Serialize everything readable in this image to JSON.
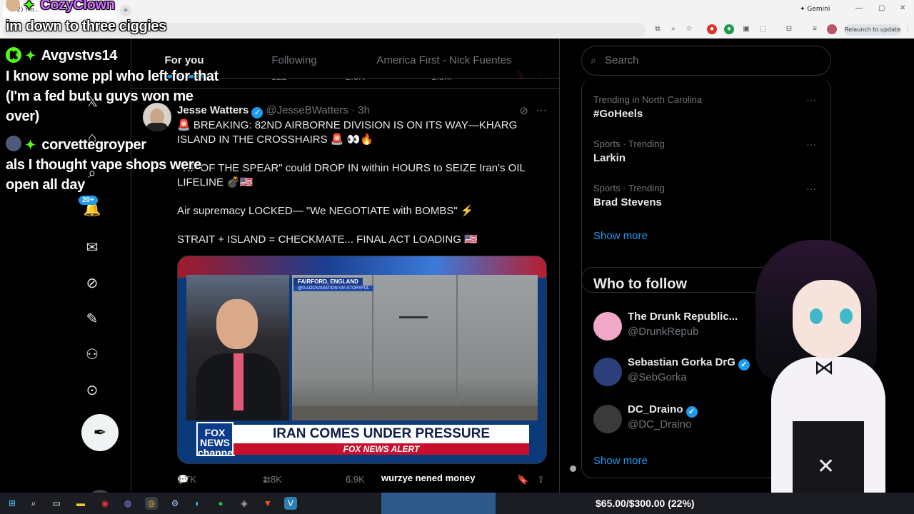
{
  "browser": {
    "tab_label": "(92) Ho...",
    "new_tab": "+",
    "gemini_label": "Gemini",
    "relaunch_label": "Relaunch to update"
  },
  "nav": {
    "notif_badge": "20+"
  },
  "feed": {
    "tabs": [
      {
        "label": "For you"
      },
      {
        "label": "Following"
      },
      {
        "label": "America First - Nick Fuentes"
      }
    ],
    "prev_tweet": {
      "replies": "122",
      "likes": "2.3K",
      "views": "1.3M"
    },
    "tweet": {
      "name": "Jesse Watters",
      "handle": "@JesseBWatters",
      "time": "3h",
      "lines": [
        "🚨 BREAKING: 82ND AIRBORNE DIVISION IS ON ITS WAY—KHARG ISLAND IN THE CROSSHAIRS 🚨 👀🔥",
        "\"TIP OF THE SPEAR\" could DROP IN within HOURS to SEIZE Iran's OIL LIFELINE 💣🇺🇸",
        "Air supremacy LOCKED— \"We NEGOTIATE with BOMBS\" ⚡",
        "STRAIT + ISLAND = CHECKMATE... FINAL ACT LOADING 🇺🇸"
      ],
      "media": {
        "location": "FAIRFORD, ENGLAND",
        "credit": "@G.LOCKAVIATION VIA STORYFUL",
        "logo": "FOX NEWS channel",
        "headline": "IRAN COMES UNDER PRESSURE",
        "alert": "FOX NEWS ALERT"
      },
      "replies": "1.7K",
      "reposts": "1.8K",
      "likes": "6.9K"
    }
  },
  "sidebar": {
    "search_placeholder": "Search",
    "trends": [
      {
        "meta": "Trending in North Carolina",
        "name": "#GoHeels"
      },
      {
        "meta": "Sports · Trending",
        "name": "Larkin"
      },
      {
        "meta": "Sports · Trending",
        "name": "Brad Stevens"
      }
    ],
    "show_more": "Show more",
    "who_to_follow_title": "Who to follow",
    "follows": [
      {
        "name": "The Drunk Republic...",
        "handle": "@DrunkRepub"
      },
      {
        "name": "Sebastian Gorka DrG",
        "handle": "@SebGorka"
      },
      {
        "name": "DC_Draino",
        "handle": "@DC_Draino"
      }
    ],
    "show_more_2": "Show more"
  },
  "stream_overlay": {
    "streamer": "CozyClown",
    "chat": [
      {
        "user": "",
        "text": "im down to three ciggies"
      },
      {
        "user": "Avgvstvs14",
        "text": "I know some ppl who left for that"
      },
      {
        "user": "",
        "text": "(I'm a fed but u guys won me"
      },
      {
        "user": "",
        "text": "over)"
      },
      {
        "user": "corvettegroyper",
        "text": ""
      },
      {
        "user": "",
        "text": "als I thought vape shops were"
      },
      {
        "user": "",
        "text": "open all day"
      }
    ],
    "caption": "wurzye nened money",
    "goal": "$65.00/$300.00 (22%)"
  }
}
